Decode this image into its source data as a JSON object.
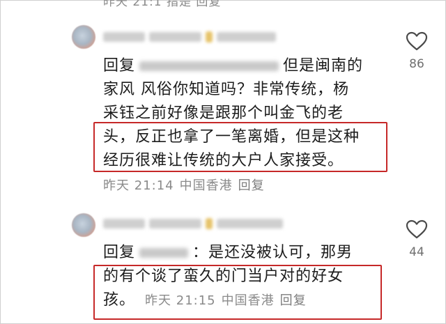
{
  "top_meta": {
    "text": "昨天 21:1  指是  回复"
  },
  "comments": [
    {
      "reply_prefix": "回复",
      "body": "：但是闽南的家风 风俗你知道吗？非常传统，杨采钰之前好像是跟那个叫金飞的老头，反正也拿了一笔离婚，但是这种经历很难让传统的大户人家接受。",
      "line1": "但是闽南的",
      "line2": "家风 风俗你知道吗？非常传统，杨",
      "line3": "采钰之前好像是跟那个叫金飞的老",
      "line4": "头，反正也拿了一笔离婚，但是这种",
      "line5": "经历很难让传统的大户人家接受。",
      "time": "昨天 21:14",
      "location": "中国香港",
      "reply_label": "回复",
      "likes": "86",
      "like_icon": "heart-outline-icon"
    },
    {
      "reply_prefix": "回复",
      "line1": "：是还没被认可，那男",
      "line2": "的有个谈了蛮久的门当户对的好女",
      "line3": "孩。",
      "time": "昨天 21:15",
      "location": "中国香港",
      "reply_label": "回复",
      "likes": "44",
      "like_icon": "heart-outline-icon"
    }
  ],
  "colors": {
    "highlight": "#c62828",
    "meta": "#8a8a8a",
    "text": "#1c1c1c"
  }
}
